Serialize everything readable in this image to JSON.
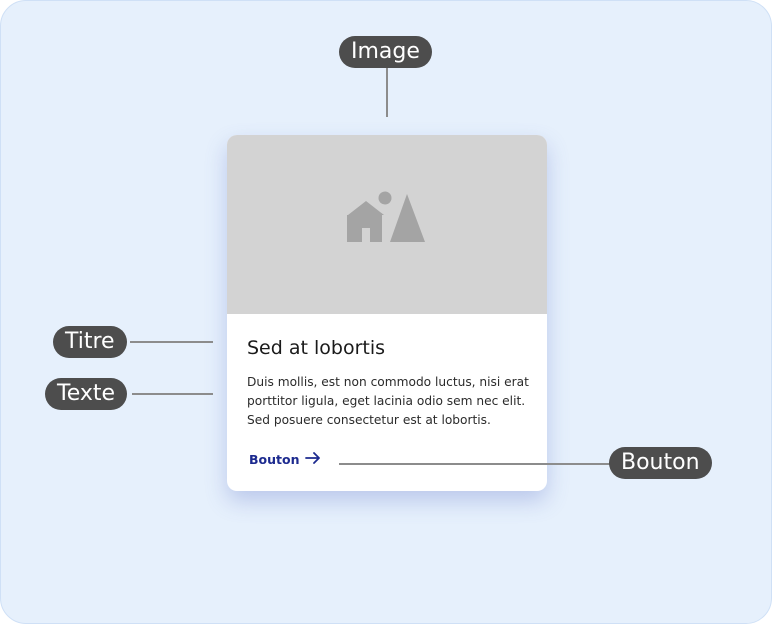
{
  "callouts": {
    "image": "Image",
    "titre": "Titre",
    "texte": "Texte",
    "bouton": "Bouton"
  },
  "card": {
    "image_icon": "image-placeholder-icon",
    "title": "Sed at lobortis",
    "text": "Duis mollis, est non commodo luctus, nisi erat porttitor ligula, eget lacinia odio sem nec elit. Sed posuere consectetur est at lobortis.",
    "button_label": "Bouton",
    "button_icon": "arrow-right-icon"
  },
  "colors": {
    "canvas": "#e6f0fc",
    "image_placeholder": "#d3d3d3",
    "callout_bg": "#4d4d4d",
    "button_text": "#1c2a8f"
  }
}
